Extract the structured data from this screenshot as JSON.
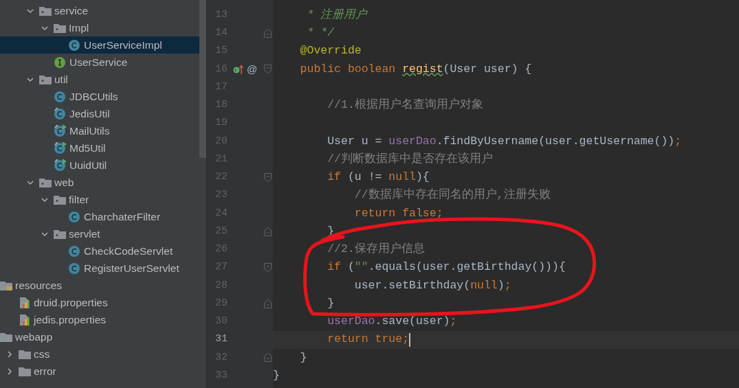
{
  "project_tree": {
    "items": [
      {
        "label": "service",
        "kind": "package",
        "expanded": true,
        "selected": false,
        "children": [
          {
            "label": "Impl",
            "kind": "package",
            "expanded": true,
            "selected": false,
            "children": [
              {
                "label": "UserServiceImpl",
                "kind": "class",
                "selected": true
              }
            ]
          },
          {
            "label": "UserService",
            "kind": "interface",
            "selected": false
          }
        ]
      },
      {
        "label": "util",
        "kind": "package",
        "expanded": true,
        "selected": false,
        "children": [
          {
            "label": "JDBCUtils",
            "kind": "class",
            "selected": false
          },
          {
            "label": "JedisUtil",
            "kind": "class-modified",
            "selected": false
          },
          {
            "label": "MailUtils",
            "kind": "class-runnable",
            "selected": false
          },
          {
            "label": "Md5Util",
            "kind": "class-runnable",
            "selected": false
          },
          {
            "label": "UuidUtil",
            "kind": "class-runnable",
            "selected": false
          }
        ]
      },
      {
        "label": "web",
        "kind": "package",
        "expanded": true,
        "selected": false,
        "children": [
          {
            "label": "filter",
            "kind": "package",
            "expanded": true,
            "selected": false,
            "children": [
              {
                "label": "CharchaterFilter",
                "kind": "class",
                "selected": false
              }
            ]
          },
          {
            "label": "servlet",
            "kind": "package",
            "expanded": true,
            "selected": false,
            "children": [
              {
                "label": "CheckCodeServlet",
                "kind": "class",
                "selected": false
              },
              {
                "label": "RegisterUserServlet",
                "kind": "class",
                "selected": false
              }
            ]
          }
        ]
      },
      {
        "label": "resources",
        "kind": "resources-root",
        "expanded": true,
        "selected": false,
        "children": [
          {
            "label": "druid.properties",
            "kind": "properties",
            "selected": false
          },
          {
            "label": "jedis.properties",
            "kind": "properties",
            "selected": false
          }
        ]
      },
      {
        "label": "webapp",
        "kind": "web-root",
        "expanded": true,
        "selected": false,
        "children": [
          {
            "label": "css",
            "kind": "folder",
            "expanded": false,
            "selected": false
          },
          {
            "label": "error",
            "kind": "folder",
            "expanded": false,
            "selected": false
          }
        ]
      }
    ]
  },
  "editor": {
    "lines": [
      {
        "number": "13",
        "tokens": [
          {
            "text": "     * 注册用户",
            "kind": "doc"
          }
        ]
      },
      {
        "number": "14",
        "fold_end": true,
        "tokens": [
          {
            "text": "     * */",
            "kind": "doc"
          }
        ]
      },
      {
        "number": "15",
        "tokens": [
          {
            "text": "    @Override",
            "kind": "annotation"
          }
        ]
      },
      {
        "number": "16",
        "fold_start": true,
        "override_marker": true,
        "gutter_mark": "@",
        "tokens": [
          {
            "text": "    public boolean ",
            "kind": "keyword"
          },
          {
            "text": "regist",
            "kind": "method",
            "warning": true
          },
          {
            "text": "(User user) {",
            "kind": "plain"
          }
        ]
      },
      {
        "number": "17"
      },
      {
        "number": "18",
        "tokens": [
          {
            "text": "        //1.根据用户名查询用户对象",
            "kind": "comment"
          }
        ]
      },
      {
        "number": "19"
      },
      {
        "number": "20",
        "tokens": [
          {
            "text": "        User u = ",
            "kind": "plain"
          },
          {
            "text": "userDao",
            "kind": "field"
          },
          {
            "text": ".findByUsername(user.getUsername())",
            "kind": "plain"
          },
          {
            "text": ";",
            "kind": "keyword"
          }
        ]
      },
      {
        "number": "21",
        "tokens": [
          {
            "text": "        //判断数据库中是否存在该用户",
            "kind": "comment"
          }
        ]
      },
      {
        "number": "22",
        "fold_start": true,
        "tokens": [
          {
            "text": "        if",
            "kind": "keyword"
          },
          {
            "text": " (u != ",
            "kind": "plain"
          },
          {
            "text": "null",
            "kind": "keyword"
          },
          {
            "text": "){",
            "kind": "plain"
          }
        ]
      },
      {
        "number": "23",
        "tokens": [
          {
            "text": "            //数据库中存在同名的用户,注册失败",
            "kind": "comment"
          }
        ]
      },
      {
        "number": "24",
        "tokens": [
          {
            "text": "            return false;",
            "kind": "keyword"
          }
        ]
      },
      {
        "number": "25",
        "fold_end": true,
        "tokens": [
          {
            "text": "        }",
            "kind": "plain"
          }
        ]
      },
      {
        "number": "26",
        "tokens": [
          {
            "text": "        //2.保存用户信息",
            "kind": "comment"
          }
        ]
      },
      {
        "number": "27",
        "fold_start": true,
        "tokens": [
          {
            "text": "        if",
            "kind": "keyword"
          },
          {
            "text": " (",
            "kind": "plain"
          },
          {
            "text": "\"\"",
            "kind": "string"
          },
          {
            "text": ".equals(user.getBirthday())){",
            "kind": "plain"
          }
        ]
      },
      {
        "number": "28",
        "tokens": [
          {
            "text": "            user.setBirthday(",
            "kind": "plain"
          },
          {
            "text": "null",
            "kind": "keyword"
          },
          {
            "text": ")",
            "kind": "plain"
          },
          {
            "text": ";",
            "kind": "keyword"
          }
        ]
      },
      {
        "number": "29",
        "fold_end": true,
        "tokens": [
          {
            "text": "        }",
            "kind": "plain"
          }
        ]
      },
      {
        "number": "30",
        "tokens": [
          {
            "text": "        userDao",
            "kind": "field"
          },
          {
            "text": ".save(user)",
            "kind": "plain"
          },
          {
            "text": ";",
            "kind": "keyword"
          }
        ]
      },
      {
        "number": "31",
        "current": true,
        "cursor": true,
        "tokens": [
          {
            "text": "        return true;",
            "kind": "keyword"
          }
        ]
      },
      {
        "number": "32",
        "fold_end": true,
        "tokens": [
          {
            "text": "    }",
            "kind": "plain"
          }
        ]
      },
      {
        "number": "33",
        "tokens": [
          {
            "text": "}",
            "kind": "plain"
          }
        ]
      }
    ]
  }
}
